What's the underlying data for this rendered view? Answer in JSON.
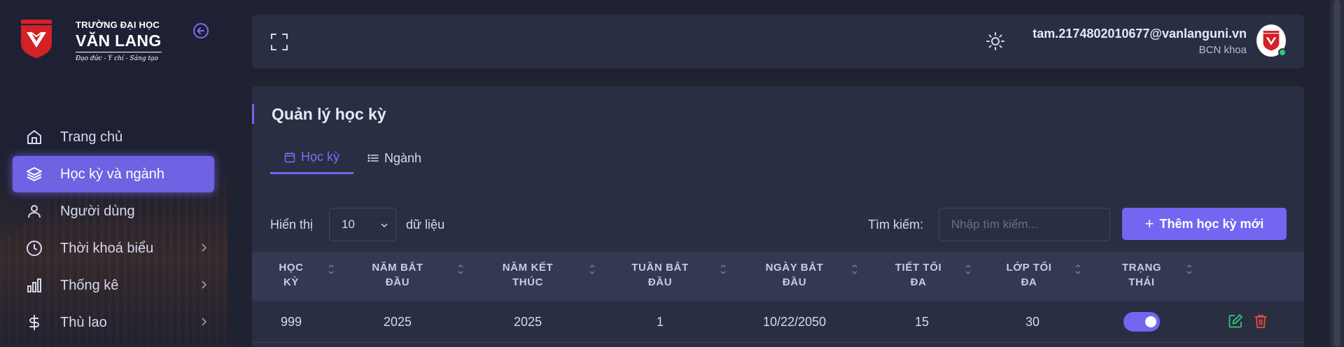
{
  "brand": {
    "line1": "TRƯỜNG ĐẠI HỌC",
    "line2": "VĂN LANG",
    "line3": "Đạo đức - Ý chí - Sáng tạo",
    "colors": {
      "shield": "#d42027",
      "accent": "#7366f0"
    }
  },
  "sidebar": {
    "items": [
      {
        "label": "Trang chủ",
        "icon": "home-icon",
        "active": false,
        "has_submenu": false
      },
      {
        "label": "Học kỳ và ngành",
        "icon": "layers-icon",
        "active": true,
        "has_submenu": false
      },
      {
        "label": "Người dùng",
        "icon": "user-icon",
        "active": false,
        "has_submenu": false
      },
      {
        "label": "Thời khoá biểu",
        "icon": "clock-icon",
        "active": false,
        "has_submenu": true
      },
      {
        "label": "Thống kê",
        "icon": "bar-chart-icon",
        "active": false,
        "has_submenu": true
      },
      {
        "label": "Thù lao",
        "icon": "dollar-icon",
        "active": false,
        "has_submenu": true
      }
    ]
  },
  "header": {
    "user_email": "tam.2174802010677@vanlanguni.vn",
    "user_role": "BCN khoa",
    "status": "online"
  },
  "main": {
    "title": "Quản lý học kỳ",
    "tabs": [
      {
        "label": "Học kỳ",
        "icon": "calendar-icon",
        "active": true
      },
      {
        "label": "Ngành",
        "icon": "list-icon",
        "active": false
      }
    ],
    "controls": {
      "show_label": "Hiển thị",
      "page_size": "10",
      "data_label": "dữ liệu",
      "search_label": "Tìm kiếm:",
      "search_placeholder": "Nhập tìm kiếm...",
      "search_value": "",
      "add_button": "Thêm học kỳ mới"
    },
    "table": {
      "headers": [
        [
          "HỌC",
          "KỲ"
        ],
        [
          "NĂM BẮT",
          "ĐẦU"
        ],
        [
          "NĂM KẾT",
          "THÚC"
        ],
        [
          "TUẦN BẮT",
          "ĐẦU"
        ],
        [
          "NGÀY BẮT",
          "ĐẦU"
        ],
        [
          "TIẾT TỐI",
          "ĐA"
        ],
        [
          "LỚP TỐI",
          "ĐA"
        ],
        [
          "TRẠNG",
          "THÁI"
        ]
      ],
      "rows": [
        {
          "cells": [
            "999",
            "2025",
            "2025",
            "1",
            "10/22/2050",
            "15",
            "30"
          ],
          "status_active": true,
          "actions": [
            "edit-icon",
            "trash-icon"
          ]
        }
      ]
    }
  }
}
